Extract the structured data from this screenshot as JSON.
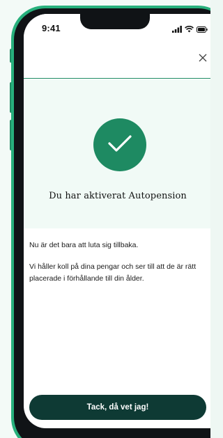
{
  "status_bar": {
    "time": "9:41",
    "icons": [
      "signal-icon",
      "wifi-icon",
      "battery-icon"
    ]
  },
  "header": {
    "close_icon": "close-icon"
  },
  "hero": {
    "icon": "checkmark-icon",
    "title": "Du har aktiverat Autopension"
  },
  "content": {
    "paragraph_1": "Nu är det bara att luta sig tillbaka.",
    "paragraph_2": "Vi håller koll på dina pengar och ser till att de är rätt placerade i förhållande till din ålder."
  },
  "cta": {
    "label": "Tack, då vet jag!"
  },
  "colors": {
    "brand_green": "#1e8a62",
    "frame_green": "#27b07c",
    "hero_background": "#f1faf6",
    "button_dark": "#0e3a34"
  }
}
